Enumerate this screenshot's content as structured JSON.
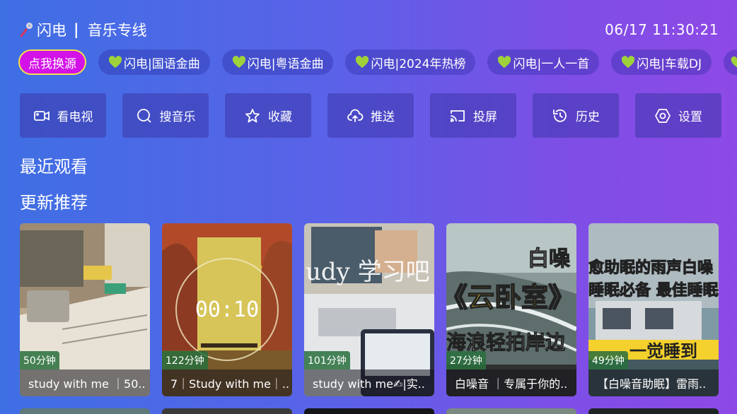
{
  "header": {
    "brand_name": "闪电",
    "brand_sub": "音乐专线",
    "separator": "|",
    "clock": "06/17 11:30:21"
  },
  "chips": [
    {
      "label": "点我换源",
      "active": true
    },
    {
      "label": "闪电|国语金曲"
    },
    {
      "label": "闪电|粤语金曲"
    },
    {
      "label": "闪电|2024年热榜"
    },
    {
      "label": "闪电|一人一首"
    },
    {
      "label": "闪电|车载DJ"
    }
  ],
  "actions": [
    {
      "label": "看电视",
      "icon": "tv-camera-icon"
    },
    {
      "label": "搜音乐",
      "icon": "search-icon"
    },
    {
      "label": "收藏",
      "icon": "star-icon"
    },
    {
      "label": "推送",
      "icon": "cloud-upload-icon"
    },
    {
      "label": "投屏",
      "icon": "cast-icon"
    },
    {
      "label": "历史",
      "icon": "history-icon"
    },
    {
      "label": "设置",
      "icon": "settings-icon"
    }
  ],
  "sections": {
    "recent": "最近观看",
    "recommend": "更新推荐"
  },
  "cards": [
    {
      "duration": "50分钟",
      "title": "study with me ｜50.."
    },
    {
      "duration": "122分钟",
      "title": "7｜Study with me｜..",
      "overlay_text": "00:10"
    },
    {
      "duration": "101分钟",
      "title": "study with me✍|实..",
      "overlay_text": "udy 学习吧！"
    },
    {
      "duration": "27分钟",
      "title": "白噪音 ｜专属于你的..",
      "overlay_text_1": "白噪",
      "overlay_text_2": "《云卧室》",
      "overlay_text_3": "海浪轻拍岸边"
    },
    {
      "duration": "49分钟",
      "title": "【白噪音助眠】雷雨..",
      "overlay_text_1": "愈助眠的雨声白噪",
      "overlay_text_2": "睡眠必备 最佳睡眠",
      "overlay_text_3": "一觉睡到"
    }
  ],
  "colors": {
    "chip_active": "#d312e8",
    "chip_active_border": "#f5e04a",
    "heart": "#9fd23a",
    "badge": "#2e7a44"
  }
}
